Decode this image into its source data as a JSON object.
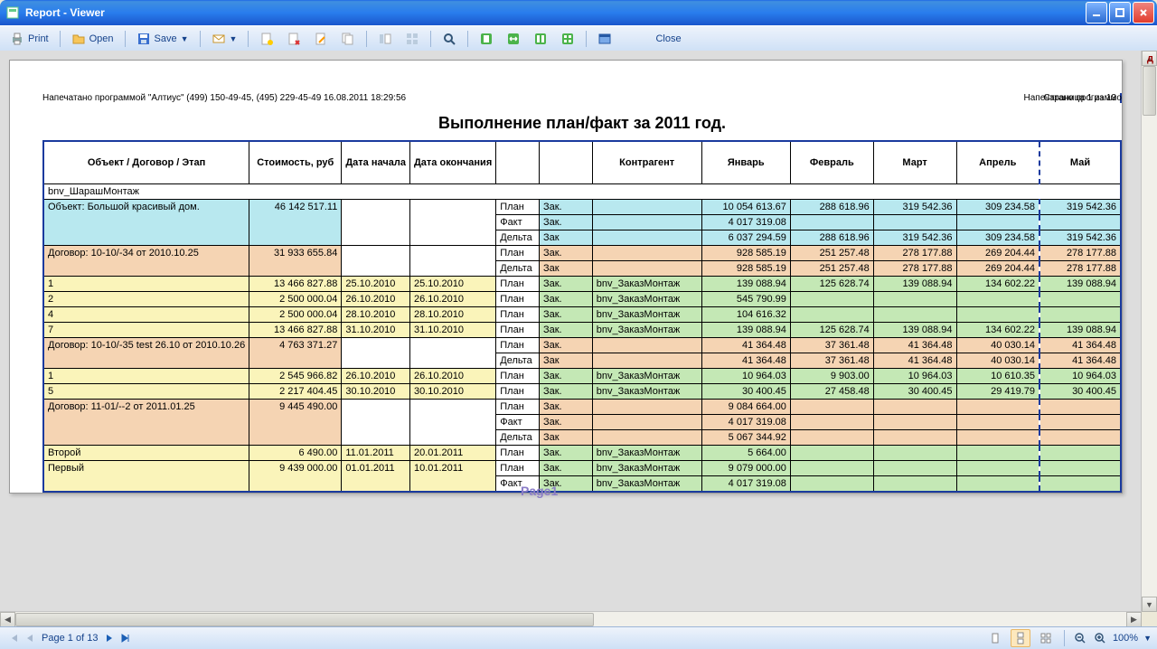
{
  "window": {
    "title": "Report - Viewer"
  },
  "toolbar": {
    "print": "Print",
    "open": "Open",
    "save": "Save",
    "close": "Close"
  },
  "report": {
    "header_left": "Напечатано программой \"Алтиус\" (499) 150-49-45, (495) 229-45-49   16.08.2011 18:29:56",
    "header_page": "Страница 1 из 13",
    "header_right": "Напечатано программо",
    "title": "Выполнение план/факт за 2011 год.",
    "watermark": "Page1",
    "columns": {
      "obj": "Объект / Договор / Этап",
      "cost": "Стоимость, руб",
      "d1": "Дата начала",
      "d2": "Дата окончания",
      "kon": "Контрагент",
      "m1": "Январь",
      "m2": "Февраль",
      "m3": "Март",
      "m4": "Апрель",
      "m5": "Май"
    },
    "group": "bnv_ШарашМонтаж",
    "rows": [
      {
        "cls": "cyan",
        "obj": "Объект: Большой красивый дом.",
        "cost": "46 142 517.11",
        "d1": "",
        "d2": "",
        "pf": "План",
        "z": "Зак.",
        "kon": "",
        "m": [
          "10 054 613.67",
          "288 618.96",
          "319 542.36",
          "309 234.58",
          "319 542.36"
        ],
        "objspan": 3,
        "costspan": 3
      },
      {
        "cls": "cyan",
        "pf": "Факт",
        "z": "Зак.",
        "kon": "",
        "m": [
          "4 017 319.08",
          "",
          "",
          "",
          ""
        ]
      },
      {
        "cls": "cyan",
        "pf": "Дельта",
        "z": "Зак",
        "kon": "",
        "m": [
          "6 037 294.59",
          "288 618.96",
          "319 542.36",
          "309 234.58",
          "319 542.36"
        ]
      },
      {
        "cls": "peach",
        "obj": "Договор: 10-10/-34 от 2010.10.25",
        "cost": "31 933 655.84",
        "d1": "",
        "d2": "",
        "pf": "План",
        "z": "Зак.",
        "kon": "",
        "m": [
          "928 585.19",
          "251 257.48",
          "278 177.88",
          "269 204.44",
          "278 177.88"
        ],
        "objspan": 2,
        "costspan": 2
      },
      {
        "cls": "peach",
        "pf": "Дельта",
        "z": "Зак",
        "kon": "",
        "m": [
          "928 585.19",
          "251 257.48",
          "278 177.88",
          "269 204.44",
          "278 177.88"
        ]
      },
      {
        "cls": "ygreen",
        "obj": "1",
        "cost": "13 466 827.88",
        "d1": "25.10.2010",
        "d2": "25.10.2010",
        "pf": "План",
        "z": "Зак.",
        "kon": "bnv_ЗаказМонтаж",
        "m": [
          "139 088.94",
          "125 628.74",
          "139 088.94",
          "134 602.22",
          "139 088.94"
        ]
      },
      {
        "cls": "ygreen",
        "obj": "2",
        "cost": "2 500 000.04",
        "d1": "26.10.2010",
        "d2": "26.10.2010",
        "pf": "План",
        "z": "Зак.",
        "kon": "bnv_ЗаказМонтаж",
        "m": [
          "545 790.99",
          "",
          "",
          "",
          ""
        ]
      },
      {
        "cls": "ygreen",
        "obj": "4",
        "cost": "2 500 000.04",
        "d1": "28.10.2010",
        "d2": "28.10.2010",
        "pf": "План",
        "z": "Зак.",
        "kon": "bnv_ЗаказМонтаж",
        "m": [
          "104 616.32",
          "",
          "",
          "",
          ""
        ]
      },
      {
        "cls": "ygreen",
        "obj": "7",
        "cost": "13 466 827.88",
        "d1": "31.10.2010",
        "d2": "31.10.2010",
        "pf": "План",
        "z": "Зак.",
        "kon": "bnv_ЗаказМонтаж",
        "m": [
          "139 088.94",
          "125 628.74",
          "139 088.94",
          "134 602.22",
          "139 088.94"
        ]
      },
      {
        "cls": "peach",
        "obj": "Договор: 10-10/-35 test 26.10 от 2010.10.26",
        "cost": "4 763 371.27",
        "d1": "",
        "d2": "",
        "pf": "План",
        "z": "Зак.",
        "kon": "",
        "m": [
          "41 364.48",
          "37 361.48",
          "41 364.48",
          "40 030.14",
          "41 364.48"
        ],
        "objspan": 2,
        "costspan": 2
      },
      {
        "cls": "peach",
        "pf": "Дельта",
        "z": "Зак",
        "kon": "",
        "m": [
          "41 364.48",
          "37 361.48",
          "41 364.48",
          "40 030.14",
          "41 364.48"
        ]
      },
      {
        "cls": "ygreen",
        "obj": "1",
        "cost": "2 545 966.82",
        "d1": "26.10.2010",
        "d2": "26.10.2010",
        "pf": "План",
        "z": "Зак.",
        "kon": "bnv_ЗаказМонтаж",
        "m": [
          "10 964.03",
          "9 903.00",
          "10 964.03",
          "10 610.35",
          "10 964.03"
        ]
      },
      {
        "cls": "ygreen",
        "obj": "5",
        "cost": "2 217 404.45",
        "d1": "30.10.2010",
        "d2": "30.10.2010",
        "pf": "План",
        "z": "Зак.",
        "kon": "bnv_ЗаказМонтаж",
        "m": [
          "30 400.45",
          "27 458.48",
          "30 400.45",
          "29 419.79",
          "30 400.45"
        ]
      },
      {
        "cls": "peach",
        "obj": "Договор: 11-01/--2 от 2011.01.25",
        "cost": "9 445 490.00",
        "d1": "",
        "d2": "",
        "pf": "План",
        "z": "Зак.",
        "kon": "",
        "m": [
          "9 084 664.00",
          "",
          "",
          "",
          ""
        ],
        "objspan": 3,
        "costspan": 3
      },
      {
        "cls": "peach",
        "pf": "Факт",
        "z": "Зак.",
        "kon": "",
        "m": [
          "4 017 319.08",
          "",
          "",
          "",
          ""
        ]
      },
      {
        "cls": "peach",
        "pf": "Дельта",
        "z": "Зак",
        "kon": "",
        "m": [
          "5 067 344.92",
          "",
          "",
          "",
          ""
        ]
      },
      {
        "cls": "ygreen",
        "obj": "Второй",
        "cost": "6 490.00",
        "d1": "11.01.2011",
        "d2": "20.01.2011",
        "pf": "План",
        "z": "Зак.",
        "kon": "bnv_ЗаказМонтаж",
        "m": [
          "5 664.00",
          "",
          "",
          "",
          ""
        ]
      },
      {
        "cls": "ygreen",
        "obj": "Первый",
        "cost": "9 439 000.00",
        "d1": "01.01.2011",
        "d2": "10.01.2011",
        "pf": "План",
        "z": "Зак.",
        "kon": "bnv_ЗаказМонтаж",
        "m": [
          "9 079 000.00",
          "",
          "",
          "",
          ""
        ],
        "objspan": 2,
        "costspan": 2
      },
      {
        "cls": "ygreen",
        "pf": "Факт",
        "z": "Зак.",
        "kon": "bnv_ЗаказМонтаж",
        "m": [
          "4 017 319.08",
          "",
          "",
          "",
          ""
        ]
      }
    ]
  },
  "status": {
    "page": "Page",
    "of": "of",
    "cur": "1",
    "total": "13",
    "zoom": "100%"
  },
  "misc": {
    "rightchar": "д"
  }
}
